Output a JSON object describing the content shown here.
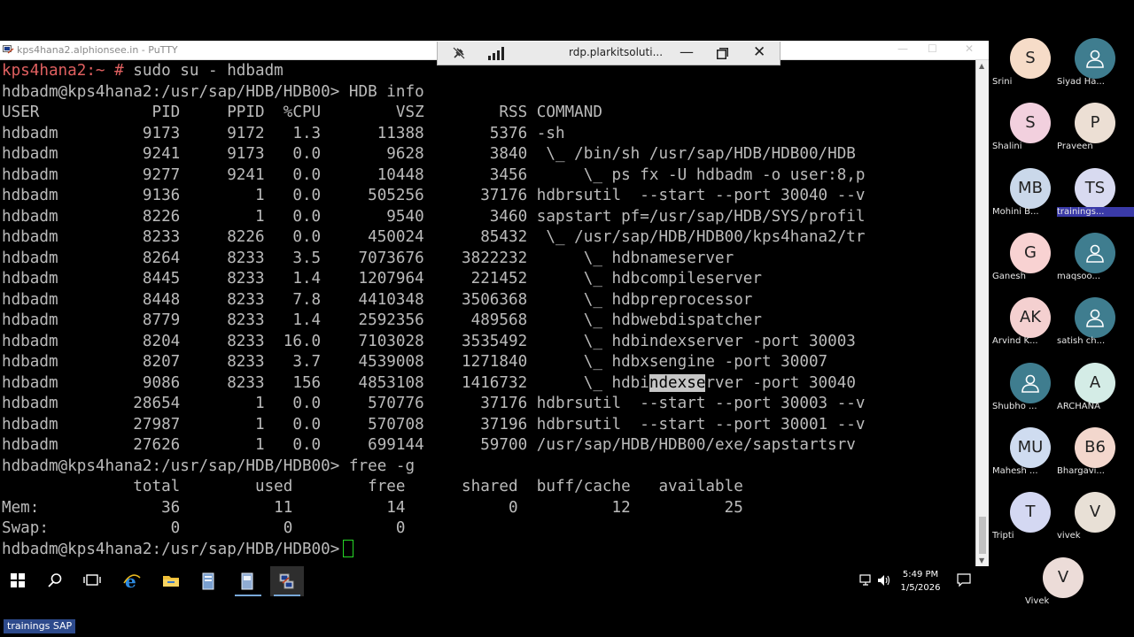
{
  "putty": {
    "title": "kps4hana2.alphionsee.in - PuTTY",
    "controls": {
      "min": "—",
      "max": "☐",
      "close": "✕"
    }
  },
  "rdp_bar": {
    "title": "rdp.plarkitsoluti...",
    "min": "—",
    "close": "✕"
  },
  "terminal": {
    "lines": [
      {
        "type": "root_prompt",
        "prompt": "kps4hana2:~ #",
        "command": " sudo su - hdbadm"
      },
      {
        "type": "plain",
        "text": "hdbadm@kps4hana2:/usr/sap/HDB/HDB00> HDB info"
      },
      {
        "type": "plain",
        "text": "USER            PID     PPID  %CPU        VSZ        RSS COMMAND"
      },
      {
        "type": "plain",
        "text": "hdbadm         9173     9172   1.3      11388       5376 -sh"
      },
      {
        "type": "plain",
        "text": "hdbadm         9241     9173   0.0       9628       3840  \\_ /bin/sh /usr/sap/HDB/HDB00/HDB"
      },
      {
        "type": "plain",
        "text": "hdbadm         9277     9241   0.0      10448       3456      \\_ ps fx -U hdbadm -o user:8,p"
      },
      {
        "type": "plain",
        "text": "hdbadm         9136        1   0.0     505256      37176 hdbrsutil  --start --port 30040 --v"
      },
      {
        "type": "plain",
        "text": "hdbadm         8226        1   0.0       9540       3460 sapstart pf=/usr/sap/HDB/SYS/profil"
      },
      {
        "type": "plain",
        "text": "hdbadm         8233     8226   0.0     450024      85432  \\_ /usr/sap/HDB/HDB00/kps4hana2/tr"
      },
      {
        "type": "plain",
        "text": "hdbadm         8264     8233   3.5    7073676    3822232      \\_ hdbnameserver"
      },
      {
        "type": "plain",
        "text": "hdbadm         8445     8233   1.4    1207964     221452      \\_ hdbcompileserver"
      },
      {
        "type": "plain",
        "text": "hdbadm         8448     8233   7.8    4410348    3506368      \\_ hdbpreprocessor"
      },
      {
        "type": "plain",
        "text": "hdbadm         8779     8233   1.4    2592356     489568      \\_ hdbwebdispatcher"
      },
      {
        "type": "plain",
        "text": "hdbadm         8204     8233  16.0    7103028    3535492      \\_ hdbindexserver -port 30003"
      },
      {
        "type": "plain",
        "text": "hdbadm         8207     8233   3.7    4539008    1271840      \\_ hdbxsengine -port 30007"
      },
      {
        "type": "highlight",
        "before": "hdbadm         9086     8233   156    4853108    1416732      \\_ hdbi",
        "selected": "ndexse",
        "after": "rver -port 30040"
      },
      {
        "type": "plain",
        "text": "hdbadm        28654        1   0.0     570776      37176 hdbrsutil  --start --port 30003 --v"
      },
      {
        "type": "plain",
        "text": "hdbadm        27987        1   0.0     570708      37196 hdbrsutil  --start --port 30001 --v"
      },
      {
        "type": "plain",
        "text": "hdbadm        27626        1   0.0     699144      59700 /usr/sap/HDB/HDB00/exe/sapstartsrv"
      },
      {
        "type": "plain",
        "text": "hdbadm@kps4hana2:/usr/sap/HDB/HDB00> free -g"
      },
      {
        "type": "plain",
        "text": "              total        used        free      shared  buff/cache   available"
      },
      {
        "type": "plain",
        "text": "Mem:             36          11          14           0          12          25"
      },
      {
        "type": "plain",
        "text": "Swap:             0           0           0"
      },
      {
        "type": "cursor_prompt",
        "text": "hdbadm@kps4hana2:/usr/sap/HDB/HDB00>"
      }
    ]
  },
  "taskbar": {
    "icons": [
      "windows-start-icon",
      "search-icon",
      "task-view-icon",
      "internet-explorer-icon",
      "file-explorer-icon",
      "server-manager-icon",
      "remote-desktop-icon",
      "putty-icon"
    ],
    "clock": {
      "time": "5:49 PM",
      "date": "1/5/2026"
    }
  },
  "participants": [
    {
      "name": "Srini",
      "initials": "S",
      "color": "#f6dcc8",
      "avatar": "initials"
    },
    {
      "name": "Siyad Ha...",
      "initials": "",
      "color": "#3f7d8f",
      "avatar": "person-icon"
    },
    {
      "name": "Shalini",
      "initials": "S",
      "color": "#f2d0de",
      "avatar": "initials"
    },
    {
      "name": "Praveen",
      "initials": "P",
      "color": "#ecdfd4",
      "avatar": "initials"
    },
    {
      "name": "Mohini B...",
      "initials": "MB",
      "color": "#cad8ea",
      "avatar": "initials"
    },
    {
      "name": "trainings...",
      "initials": "TS",
      "color": "#d8daf0",
      "avatar": "initials",
      "highlighted": true
    },
    {
      "name": "Ganesh",
      "initials": "G",
      "color": "#f8d2d2",
      "avatar": "initials"
    },
    {
      "name": "maqsoo...",
      "initials": "",
      "color": "#3f7d8f",
      "avatar": "person-icon"
    },
    {
      "name": "Arvind K...",
      "initials": "AK",
      "color": "#f4d0d0",
      "avatar": "initials"
    },
    {
      "name": "satish ch...",
      "initials": "",
      "color": "#3f7d8f",
      "avatar": "person-icon"
    },
    {
      "name": "Shubho ...",
      "initials": "",
      "color": "#3f7d8f",
      "avatar": "person-icon"
    },
    {
      "name": "ARCHANA",
      "initials": "A",
      "color": "#d4ece6",
      "avatar": "initials"
    },
    {
      "name": "Mahesh ...",
      "initials": "MU",
      "color": "#cfdcf0",
      "avatar": "initials"
    },
    {
      "name": "Bhargavi...",
      "initials": "B6",
      "color": "#f3d7cd",
      "avatar": "initials"
    },
    {
      "name": "Tripti",
      "initials": "T",
      "color": "#d4d8f2",
      "avatar": "initials"
    },
    {
      "name": "vivek",
      "initials": "V",
      "color": "#e8e0d6",
      "avatar": "initials"
    },
    {
      "name": "Vivek",
      "initials": "V",
      "color": "#ecdcd8",
      "avatar": "initials"
    }
  ],
  "caption": "trainings SAP"
}
